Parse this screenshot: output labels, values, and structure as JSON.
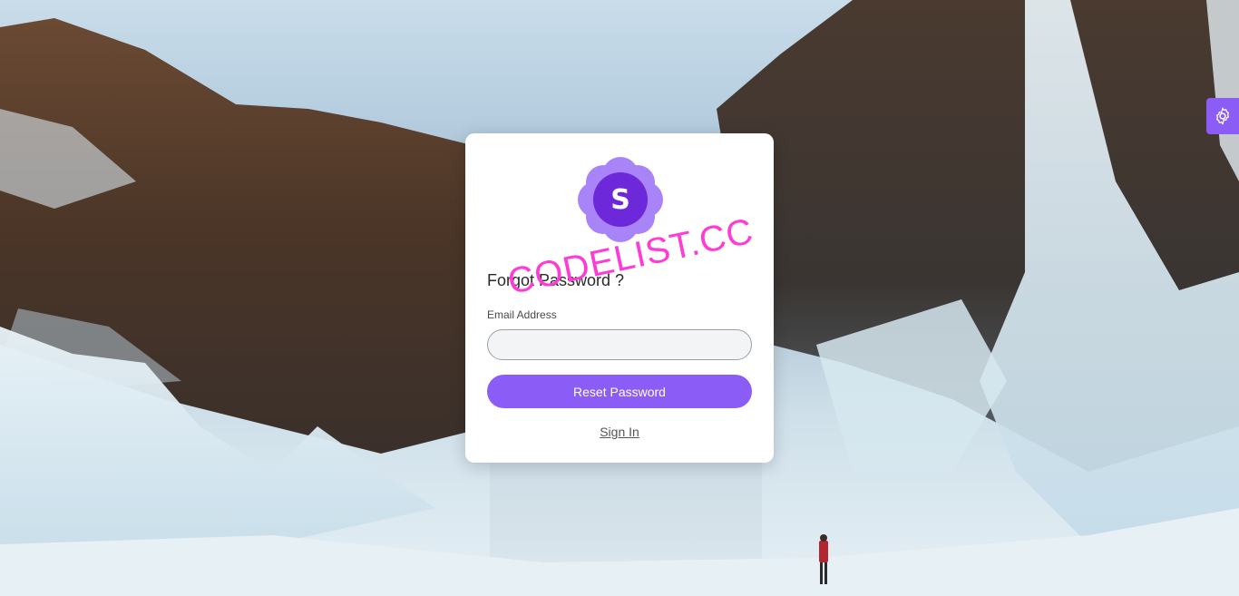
{
  "brand": {
    "logo_letter": "S",
    "accent_color": "#8b5cf6"
  },
  "form": {
    "title": "Forgot Password ?",
    "email_label": "Email Address",
    "email_value": "",
    "submit_label": "Reset Password",
    "signin_link": "Sign In"
  },
  "overlay": {
    "watermark": "CODELIST.CC"
  },
  "icons": {
    "settings": "gear-icon",
    "logo": "flower-logo-icon"
  }
}
